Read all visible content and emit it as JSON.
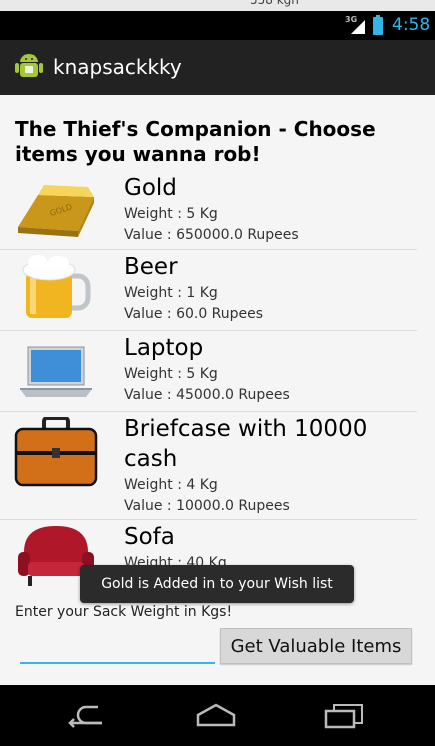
{
  "system": {
    "time": "4:58",
    "network": "3G"
  },
  "app": {
    "title": "knapsackkky"
  },
  "main": {
    "heading": "The Thief's Companion - Choose items you wanna rob!",
    "items": [
      {
        "name": "Gold",
        "weight": "Weight : 5 Kg",
        "value": "Value : 650000.0 Rupees",
        "icon": "gold-bar-icon"
      },
      {
        "name": "Beer",
        "weight": "Weight : 1 Kg",
        "value": "Value : 60.0 Rupees",
        "icon": "beer-mug-icon"
      },
      {
        "name": "Laptop",
        "weight": "Weight : 5 Kg",
        "value": "Value : 45000.0 Rupees",
        "icon": "laptop-icon"
      },
      {
        "name": "Briefcase with 10000 cash",
        "weight": "Weight : 4 Kg",
        "value": "Value : 10000.0 Rupees",
        "icon": "briefcase-icon"
      },
      {
        "name": "Sofa",
        "weight": "Weight : 40 Kg",
        "value": "",
        "icon": "sofa-icon"
      }
    ],
    "toast": "Gold is Added in to your Wish list",
    "sack_label": "Enter your Sack Weight in Kgs!",
    "sack_value": "",
    "get_button": "Get Valuable Items"
  },
  "colors": {
    "accent": "#33b5e5",
    "action_bar": "#222222",
    "background": "#f5f5f5"
  }
}
